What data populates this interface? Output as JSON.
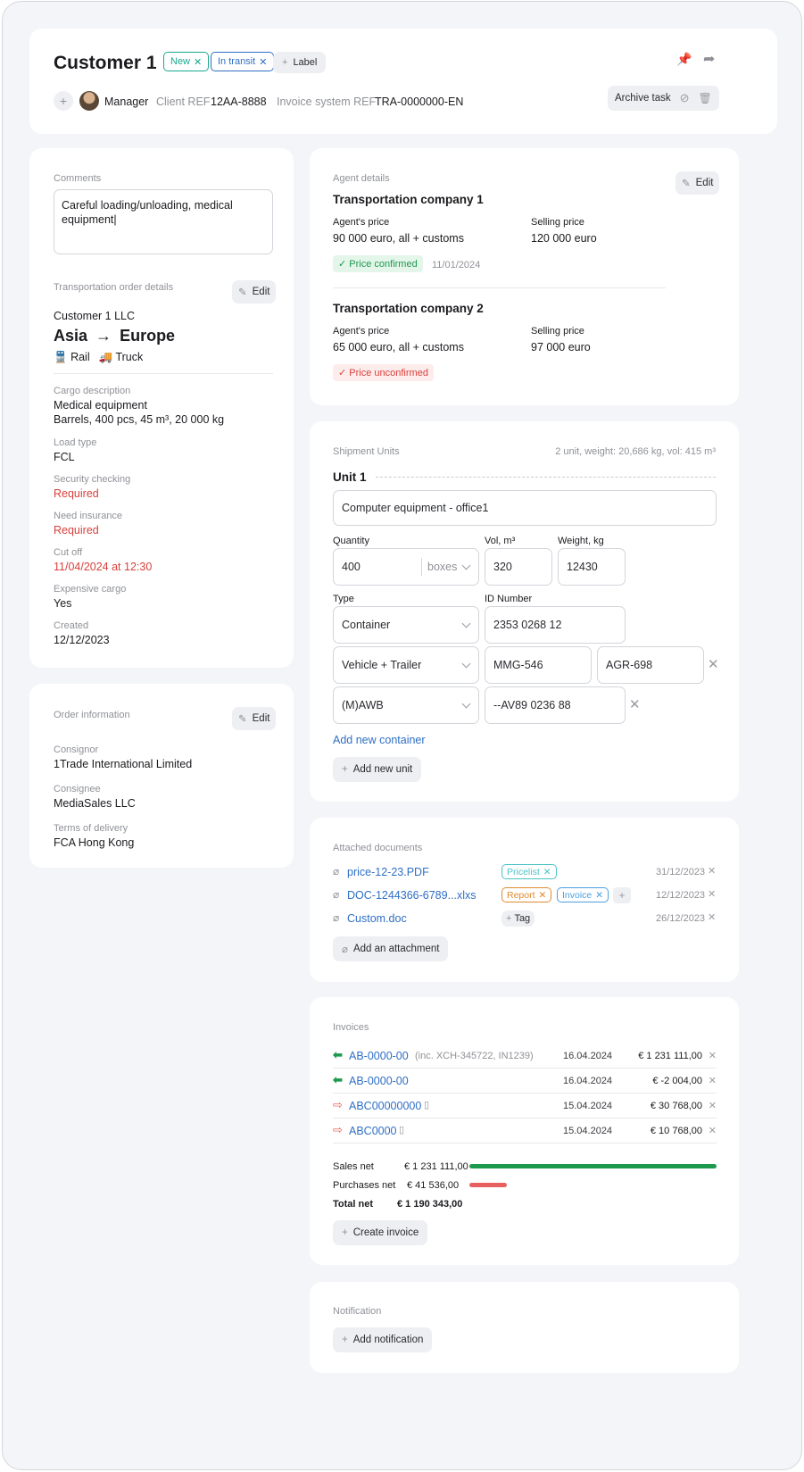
{
  "header": {
    "title": "Customer 1",
    "tags": [
      {
        "label": "New",
        "color": "#19a88f"
      },
      {
        "label": "In transit",
        "color": "#2f6fc4"
      }
    ],
    "label_button": "Label",
    "manager": "Manager",
    "client_ref_label": "Client REF",
    "client_ref": "12AA-8888",
    "invoice_ref_label": "Invoice system REF",
    "invoice_ref": "TRA-0000000-EN",
    "archive_label": "Archive task",
    "icons": [
      "plus-icon",
      "avatar",
      "pin-icon",
      "share-icon",
      "block-icon",
      "trash-icon"
    ]
  },
  "comments": {
    "title": "Comments",
    "text": "Careful loading/unloading, medical equipment|"
  },
  "transport": {
    "title": "Transportation order details",
    "edit": "Edit",
    "company": "Customer 1 LLC",
    "route_from": "Asia",
    "route_arrow": "→",
    "route_to": "Europe",
    "modes": [
      "Rail",
      "Truck"
    ],
    "fields": [
      {
        "label": "Cargo description",
        "value": "Medical equipment",
        "value2": "Barrels, 400 pcs, 45 m³, 20 000 kg"
      },
      {
        "label": "Load type",
        "value": "FCL"
      },
      {
        "label": "Security checking",
        "value": "Required"
      },
      {
        "label": "Need insurance",
        "value": "Required"
      },
      {
        "label": "Cut off",
        "value": "11/04/2024 at 12:30"
      },
      {
        "label": "Expensive cargo",
        "value": "Yes"
      },
      {
        "label": "Created",
        "value": "12/12/2023"
      }
    ]
  },
  "order": {
    "title": "Order information",
    "edit": "Edit",
    "fields": [
      {
        "label": "Consignor",
        "value": "1Trade International Limited"
      },
      {
        "label": "Consignee",
        "value": "MediaSales LLC"
      },
      {
        "label": "Terms of delivery",
        "value": "FCA Hong Kong"
      }
    ]
  },
  "agent": {
    "title": "Agent details",
    "edit": "Edit",
    "agents_price_label": "Agent's price",
    "selling_price_label": "Selling price",
    "companies": [
      {
        "name": "Transportation company 1",
        "agent_price": "90 000 euro, all + customs",
        "selling_price": "120 000 euro",
        "status": "Price confirmed",
        "date": "11/01/2024"
      },
      {
        "name": "Transportation company 2",
        "agent_price": "65 000 euro, all + customs",
        "selling_price": "97 000 euro",
        "status": "Price unconfirmed",
        "date": ""
      }
    ]
  },
  "shipment": {
    "title": "Shipment Units",
    "summary": "2 unit, weight: 20,686 kg, vol: 415 m³",
    "unit_title": "Unit 1",
    "name": "Computer equipment - office1",
    "quantity_label": "Quantity",
    "quantity": "400",
    "quantity_unit": "boxes",
    "vol_label": "Vol, m³",
    "vol": "320",
    "weight_label": "Weight, kg",
    "weight": "12430",
    "type_label": "Type",
    "id_label": "ID Number",
    "rows": [
      {
        "type": "Container",
        "id1": "2353 0268 12",
        "id2": ""
      },
      {
        "type": "Vehicle + Trailer",
        "id1": "MMG-546",
        "id2": "AGR-698"
      },
      {
        "type": "(M)AWB",
        "id1": "--AV89 0236 88",
        "id2": ""
      }
    ],
    "add_container": "Add new container",
    "add_unit": "Add new unit"
  },
  "documents": {
    "title": "Attached documents",
    "items": [
      {
        "name": "price-12-23.PDF",
        "tags": [
          {
            "label": "Pricelist",
            "color": "#4cc3c7"
          }
        ],
        "date": "31/12/2023"
      },
      {
        "name": "DOC-1244366-6789...xlxs",
        "tags": [
          {
            "label": "Report",
            "color": "#e08a2e"
          },
          {
            "label": "Invoice",
            "color": "#4a9fe0"
          }
        ],
        "date": "12/12/2023"
      },
      {
        "name": "Custom.doc",
        "tags": [],
        "tag_button": "Tag",
        "date": "26/12/2023"
      }
    ],
    "add": "Add an attachment"
  },
  "invoices": {
    "title": "Invoices",
    "items": [
      {
        "id": "AB-0000-00",
        "note": "(inc. XCH-345722, IN1239)",
        "date": "16.04.2024",
        "amount": "€ 1 231 111,00",
        "direction": "in"
      },
      {
        "id": "AB-0000-00",
        "note": "",
        "date": "16.04.2024",
        "amount": "€ -2 004,00",
        "direction": "in"
      },
      {
        "id": "ABC00000000",
        "note": "",
        "date": "15.04.2024",
        "amount": "€ 30 768,00",
        "direction": "out"
      },
      {
        "id": "ABC0000",
        "note": "",
        "date": "15.04.2024",
        "amount": "€ 10 768,00",
        "direction": "out"
      }
    ],
    "sales_label": "Sales net",
    "sales_value": "€ 1 231 111,00",
    "sales_fraction": 1.0,
    "purchases_label": "Purchases net",
    "purchases_value": "€ 41 536,00",
    "purchases_fraction": 0.15,
    "total_label": "Total net",
    "total_value": "€ 1 190 343,00",
    "create": "Create invoice",
    "colors": {
      "sales": "#1e9a4e",
      "purchases": "#e85f5f"
    }
  },
  "notification": {
    "title": "Notification",
    "add": "Add notification"
  }
}
